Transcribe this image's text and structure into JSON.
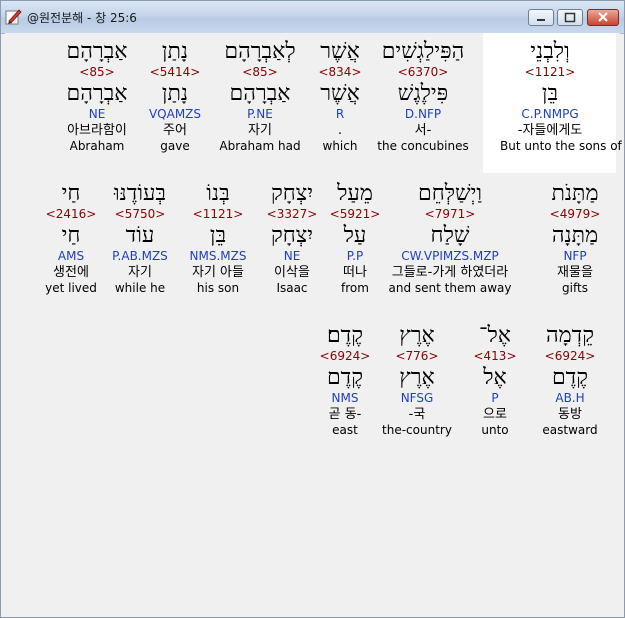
{
  "window": {
    "title": "@원전분해 - 창 25:6",
    "colors": {
      "strong": "#8b0000",
      "morph": "#1f3fbf"
    }
  },
  "rows": [
    {
      "words": [
        {
          "heb": "וְלִבְנֵי",
          "strong": "<1121>",
          "lemma": "בֵּן",
          "morph": "C.P.NMPG",
          "kor": "-자들에게도",
          "eng": "But unto the sons of"
        },
        {
          "heb": "הַפִּילַגְשִׁים",
          "strong": "<6370>",
          "lemma": "פִּילֶגֶשׁ",
          "morph": "D.NFP",
          "kor": "서-",
          "eng": "the concubines"
        },
        {
          "heb": "אֲשֶׁר",
          "strong": "<834>",
          "lemma": "אֲשֶׁר",
          "morph": "R",
          "kor": ".",
          "eng": "which"
        },
        {
          "heb": "לְאַבְרָהָם",
          "strong": "<85>",
          "lemma": "אַבְרָהָם",
          "morph": "P.NE",
          "kor": "자기",
          "eng": "Abraham had"
        },
        {
          "heb": "נָתַן",
          "strong": "<5414>",
          "lemma": "נָתַן",
          "morph": "VQAMZS",
          "kor": "주어",
          "eng": "gave"
        },
        {
          "heb": "אַבְרָהָם",
          "strong": "<85>",
          "lemma": "אַבְרָהָם",
          "morph": "NE",
          "kor": "아브라함이",
          "eng": "Abraham"
        }
      ]
    },
    {
      "words": [
        {
          "heb": "מַתָּנֹת",
          "strong": "<4979>",
          "lemma": "מַתָּנָה",
          "morph": "NFP",
          "kor": "재물을",
          "eng": "gifts"
        },
        {
          "heb": "וַיְשַׁלְּחֵם",
          "strong": "<7971>",
          "lemma": "שָׁלַח",
          "morph": "CW.VPIMZS.MZP",
          "kor": "그들로-가게 하였더라",
          "eng": "and sent them away"
        },
        {
          "heb": "מֵעַל",
          "strong": "<5921>",
          "lemma": "עַל",
          "morph": "P.P",
          "kor": "떠나",
          "eng": "from"
        },
        {
          "heb": "יִצְחָק",
          "strong": "<3327>",
          "lemma": "יִצְחָק",
          "morph": "NE",
          "kor": "이삭을",
          "eng": "Isaac"
        },
        {
          "heb": "בְּנוֹ",
          "strong": "<1121>",
          "lemma": "בֵּן",
          "morph": "NMS.MZS",
          "kor": "자기 아들",
          "eng": "his son"
        },
        {
          "heb": "בְּעוֹדֶנּוּ",
          "strong": "<5750>",
          "lemma": "עוֹד",
          "morph": "P.AB.MZS",
          "kor": "자기",
          "eng": "while he"
        },
        {
          "heb": "חַי",
          "strong": "<2416>",
          "lemma": "חַי",
          "morph": "AMS",
          "kor": "생전에",
          "eng": "yet lived"
        }
      ]
    },
    {
      "words": [
        {
          "heb": "קֵדְמָה",
          "strong": "<6924>",
          "lemma": "קֶדֶם",
          "morph": "AB.H",
          "kor": "동방",
          "eng": "eastward"
        },
        {
          "heb": "אֶל־",
          "strong": "<413>",
          "lemma": "אֶל",
          "morph": "P",
          "kor": "으로",
          "eng": "unto"
        },
        {
          "heb": "אֶרֶץ",
          "strong": "<776>",
          "lemma": "אֶרֶץ",
          "morph": "NFSG",
          "kor": "-국",
          "eng": "the-country"
        },
        {
          "heb": "קֶדֶם׃",
          "strong": "<6924>",
          "lemma": "קֶדֶם",
          "morph": "NMS",
          "kor": "곧 동-",
          "eng": "east"
        }
      ]
    }
  ]
}
